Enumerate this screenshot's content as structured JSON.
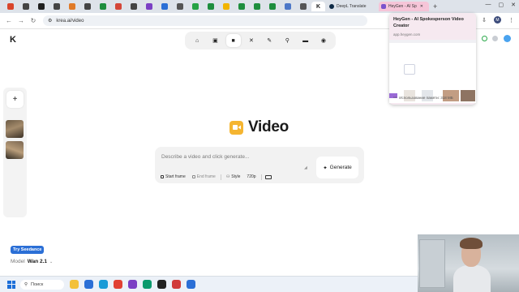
{
  "browser": {
    "tabs": [
      {
        "icon": "rings-icon",
        "color": "#d9452b"
      },
      {
        "icon": "ring-icon",
        "color": "#444444"
      },
      {
        "icon": "board-icon",
        "color": "#1f1f1f"
      },
      {
        "icon": "ring-icon",
        "color": "#444444"
      },
      {
        "icon": "basketball-icon",
        "color": "#e07a28"
      },
      {
        "icon": "ring-icon",
        "color": "#444444"
      },
      {
        "icon": "sheets-icon",
        "color": "#1e8e3e"
      },
      {
        "icon": "gmail-icon",
        "color": "#d44638"
      },
      {
        "icon": "ring-icon",
        "color": "#444444"
      },
      {
        "icon": "purple-app-icon",
        "color": "#7b3fc4"
      },
      {
        "icon": "chat-icon",
        "color": "#2b6fd6"
      },
      {
        "icon": "swirl-icon",
        "color": "#555555"
      },
      {
        "icon": "whatsapp-icon",
        "color": "#25a244"
      },
      {
        "icon": "drive-icon",
        "color": "#1e8e3e"
      },
      {
        "icon": "star-icon",
        "color": "#f2b400"
      },
      {
        "icon": "sheets-icon",
        "color": "#1e8e3e"
      },
      {
        "icon": "sheets-icon",
        "color": "#1e8e3e"
      },
      {
        "icon": "sheets-icon",
        "color": "#1e8e3e"
      },
      {
        "icon": "brush-icon",
        "color": "#4d78c8"
      },
      {
        "icon": "swirl-icon",
        "color": "#555555"
      }
    ],
    "current_tab_icon": "krea-icon",
    "deepl_tab": "DeepL Translate",
    "heygen_tab": "HeyGen - AI Sp",
    "url": "krea.ai/video",
    "profile_initial": "M"
  },
  "popup": {
    "title": "HeyGen - AI Spokesperson Video Creator",
    "url": "app.heygen.com",
    "memory": "Использование памяти: 318 МБ"
  },
  "app": {
    "logo": "K",
    "modes": [
      {
        "name": "home-icon",
        "glyph": "⌂"
      },
      {
        "name": "image-icon",
        "glyph": "▣"
      },
      {
        "name": "video-icon",
        "glyph": "■"
      },
      {
        "name": "enhance-icon",
        "glyph": "✕"
      },
      {
        "name": "edit-icon",
        "glyph": "✎"
      },
      {
        "name": "train-icon",
        "glyph": "⚲"
      },
      {
        "name": "assets-icon",
        "glyph": "▬"
      },
      {
        "name": "realtime-icon",
        "glyph": "◉"
      }
    ],
    "title": "Video",
    "prompt_placeholder": "Describe a video and click generate...",
    "generate_label": "Generate",
    "chips": {
      "start_frame": "Start frame",
      "end_frame": "End frame",
      "style": "Style",
      "resolution": "720p"
    },
    "try_badge": "Try Seedance",
    "model_label": "Model",
    "model_value": "Wan 2.1"
  },
  "taskbar": {
    "search_label": "Поиск",
    "apps": [
      {
        "name": "file-explorer-icon",
        "color": "#f3c13a"
      },
      {
        "name": "store-icon",
        "color": "#2b6fd6"
      },
      {
        "name": "edge-icon",
        "color": "#1a9bd7"
      },
      {
        "name": "chrome-icon",
        "color": "#e14133"
      },
      {
        "name": "app-icon",
        "color": "#7b3fc4"
      },
      {
        "name": "chat-app-icon",
        "color": "#0b9a6d"
      },
      {
        "name": "github-icon",
        "color": "#222222"
      },
      {
        "name": "media-icon",
        "color": "#d13b3b"
      },
      {
        "name": "chrome-beta-icon",
        "color": "#2b6fd6"
      }
    ]
  }
}
